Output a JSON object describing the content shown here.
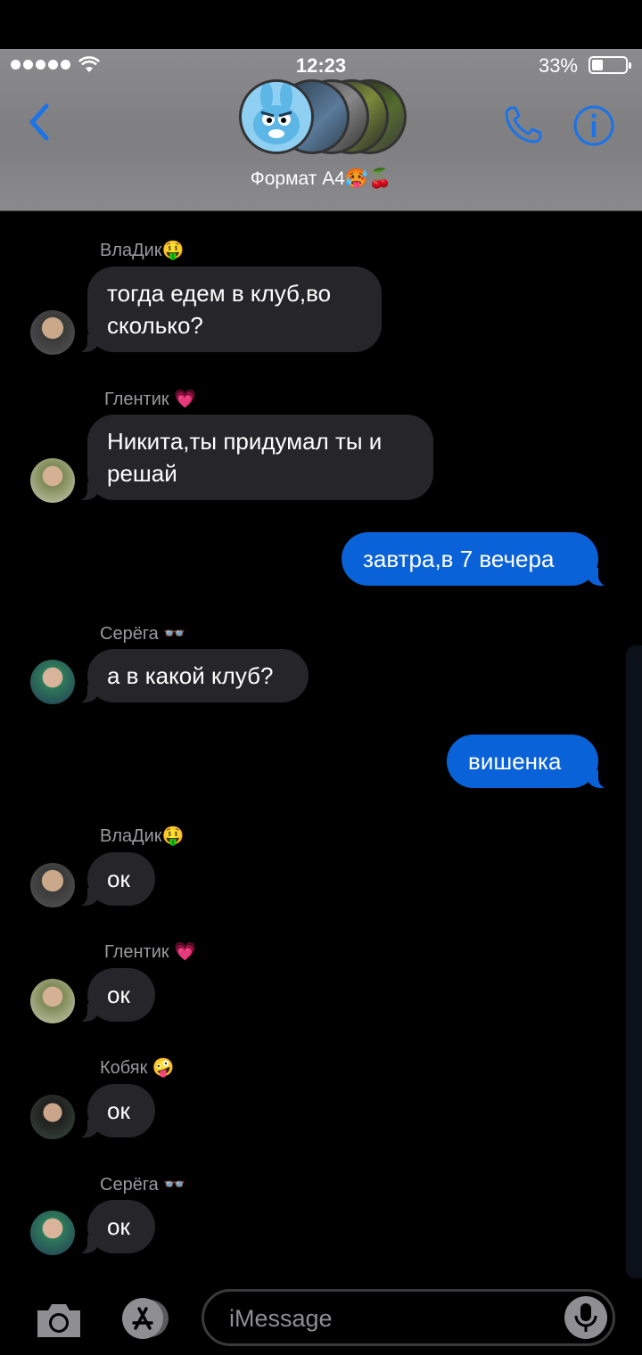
{
  "status": {
    "time": "12:23",
    "battery": "33%"
  },
  "header": {
    "group_name": "Формат А4🥵🍒"
  },
  "messages": [
    {
      "sender": "ВлаДик🤑",
      "text": "тогда едем в клуб,во сколько?"
    },
    {
      "sender": "Глентик 💗",
      "text": "Никита,ты придумал ты и решай"
    },
    {
      "text": "завтра,в 7 вечера"
    },
    {
      "sender": "Серёга 👓",
      "text": "а в какой клуб?"
    },
    {
      "text": "вишенка"
    },
    {
      "sender": "ВлаДик🤑",
      "text": "ок"
    },
    {
      "sender": "Глентик 💗",
      "text": "ок"
    },
    {
      "sender": "Кобяк 🤪",
      "text": "ок"
    },
    {
      "sender": "Серёга 👓",
      "text": "ок"
    }
  ],
  "input": {
    "placeholder": "iMessage"
  },
  "colors": {
    "accent": "#0a62d8",
    "incoming": "#262529",
    "icons": "#1a73e8"
  },
  "icons": [
    "back-icon",
    "phone-icon",
    "info-icon",
    "camera-icon",
    "app-store-icon",
    "mic-icon",
    "wifi-icon"
  ]
}
